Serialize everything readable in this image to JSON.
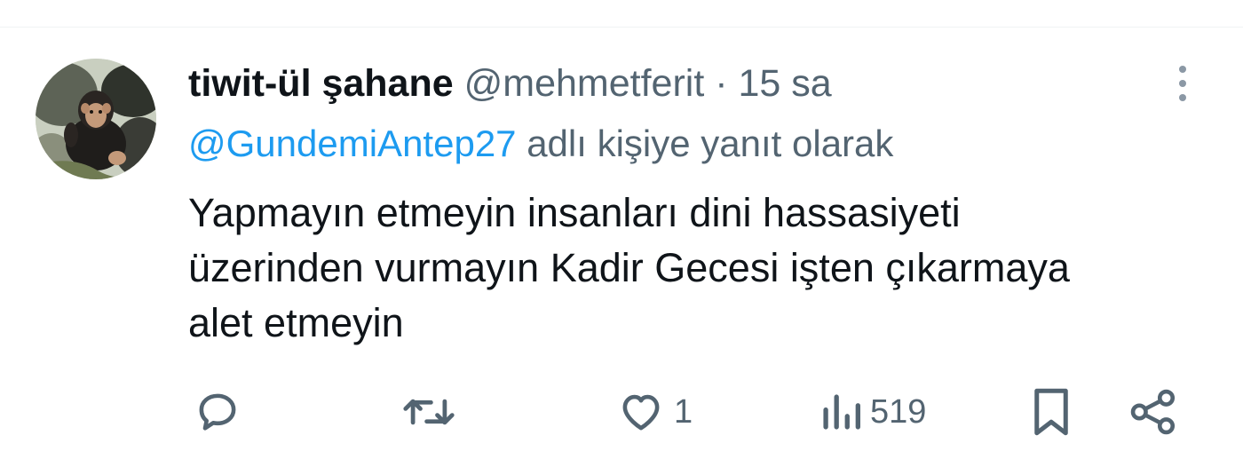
{
  "tweet": {
    "display_name": "tiwit-ül şahane",
    "handle": "@mehmetferit",
    "separator": "·",
    "time": "15 sa",
    "reply_to": {
      "mention": "@GundemiAntep27",
      "suffix": "adlı kişiye yanıt olarak"
    },
    "body_lines": [
      "Yapmayın etmeyin insanları dini hassasiyeti",
      "üzerinden vurmayın Kadir Gecesi işten çıkarmaya",
      "alet etmeyin"
    ]
  },
  "actions": {
    "reply": {
      "icon": "reply-icon",
      "count": ""
    },
    "retweet": {
      "icon": "retweet-icon",
      "count": ""
    },
    "like": {
      "icon": "heart-icon",
      "count": "1"
    },
    "views": {
      "icon": "views-icon",
      "count": "519"
    },
    "bookmark": {
      "icon": "bookmark-icon"
    },
    "share": {
      "icon": "share-icon"
    }
  },
  "colors": {
    "text_primary": "#0f1419",
    "text_secondary": "#536471",
    "link": "#1d9bf0",
    "divider": "#eff3f4"
  }
}
